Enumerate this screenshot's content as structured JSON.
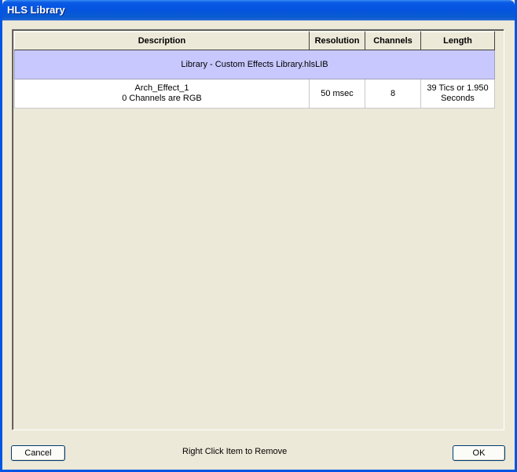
{
  "window": {
    "title": "HLS Library"
  },
  "table": {
    "headers": [
      "Description",
      "Resolution",
      "Channels",
      "Length"
    ],
    "group_label": "Library - Custom Effects Library.hlsLIB",
    "rows": [
      {
        "description_line1": "Arch_Effect_1",
        "description_line2": "0 Channels are RGB",
        "resolution": "50 msec",
        "channels": "8",
        "length_line1": "39 Tics or 1.950",
        "length_line2": "Seconds"
      }
    ]
  },
  "footer": {
    "cancel_label": "Cancel",
    "hint": "Right Click Item to Remove",
    "ok_label": "OK"
  }
}
